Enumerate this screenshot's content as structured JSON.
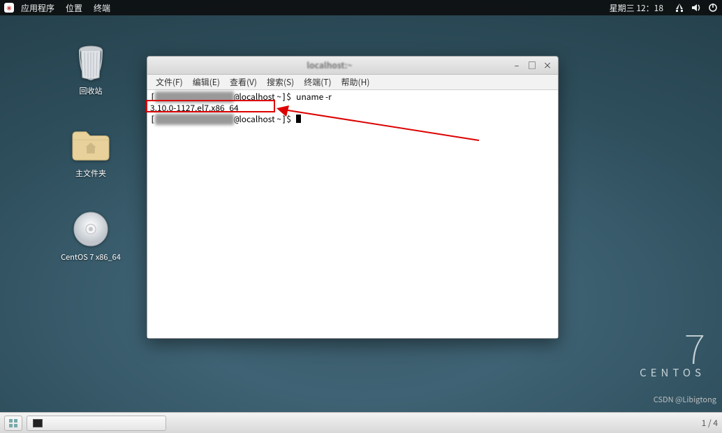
{
  "topbar": {
    "menu": [
      "应用程序",
      "位置",
      "终端"
    ],
    "clock": "星期三 12：18"
  },
  "desktop_icons": {
    "trash": "回收站",
    "home": "主文件夹",
    "disc": "CentOS 7 x86_64"
  },
  "terminal_window": {
    "title": "localhost:~",
    "menubar": [
      "文件(F)",
      "编辑(E)",
      "查看(V)",
      "搜索(S)",
      "终端(T)",
      "帮助(H)"
    ],
    "controls": {
      "minimize": "–",
      "maximize": "□",
      "close": "×"
    },
    "lines": {
      "prompt_host": "localhost ~",
      "prompt_symbol": "$",
      "command": "uname -r",
      "output": "3.10.0-1127.el7.x86_64"
    }
  },
  "branding": {
    "version": "7",
    "name": "CENTOS"
  },
  "watermark": "CSDN @Libigtong",
  "taskbar": {
    "ws_indicator": "1 / 4"
  }
}
